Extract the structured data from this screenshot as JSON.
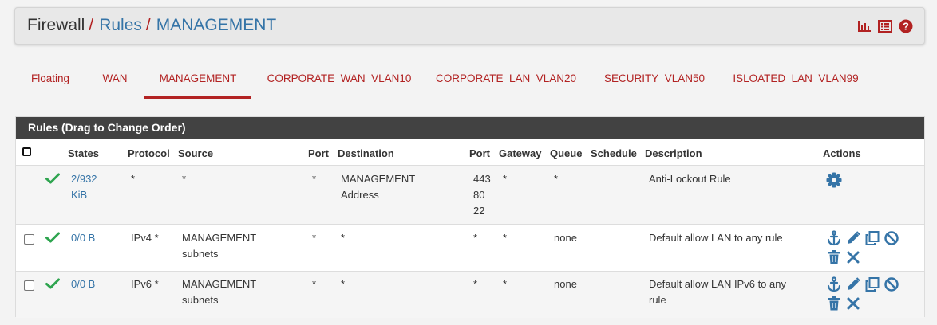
{
  "breadcrumb": {
    "root": "Firewall",
    "separator": "/",
    "level2": "Rules",
    "level3": "MANAGEMENT"
  },
  "header_icons": [
    "chart-icon",
    "log-list-icon",
    "help-icon"
  ],
  "tabs": [
    {
      "label": "Floating"
    },
    {
      "label": "WAN"
    },
    {
      "label": "MANAGEMENT",
      "active": true
    },
    {
      "label": "CORPORATE_WAN_VLAN10"
    },
    {
      "label": "CORPORATE_LAN_VLAN20"
    },
    {
      "label": "SECURITY_VLAN50"
    },
    {
      "label": "ISLOATED_LAN_VLAN99"
    }
  ],
  "panel": {
    "title": "Rules (Drag to Change Order)"
  },
  "columns": {
    "states": "States",
    "protocol": "Protocol",
    "source": "Source",
    "port": "Port",
    "destination": "Destination",
    "port2": "Port",
    "gateway": "Gateway",
    "queue": "Queue",
    "schedule": "Schedule",
    "description": "Description",
    "actions": "Actions"
  },
  "rules": [
    {
      "states_line1": "2/932",
      "states_line2": "KiB",
      "protocol": "*",
      "source_line1": "*",
      "source_line2": "",
      "port": "*",
      "destination_line1": "MANAGEMENT",
      "destination_line2": "Address",
      "dest_ports": [
        "443",
        "80",
        "22"
      ],
      "gateway": "*",
      "queue": "*",
      "schedule": "",
      "description_line1": "Anti-Lockout Rule",
      "description_line2": ""
    },
    {
      "states_line1": "0/0 B",
      "protocol": "IPv4 *",
      "source_line1": "MANAGEMENT",
      "source_line2": "subnets",
      "port": "*",
      "destination_line1": "*",
      "dest_port": "*",
      "gateway": "*",
      "queue": "none",
      "schedule": "",
      "description_line1": "Default allow LAN to any rule",
      "description_line2": ""
    },
    {
      "states_line1": "0/0 B",
      "protocol": "IPv6 *",
      "source_line1": "MANAGEMENT",
      "source_line2": "subnets",
      "port": "*",
      "destination_line1": "*",
      "dest_port": "*",
      "gateway": "*",
      "queue": "none",
      "schedule": "",
      "description_line1": "Default allow LAN IPv6 to any",
      "description_line2": "rule"
    }
  ],
  "colors": {
    "accent_red": "#b22222",
    "link_blue": "#3574a7",
    "check_green": "#2ea44f",
    "panel_header": "#424242"
  }
}
